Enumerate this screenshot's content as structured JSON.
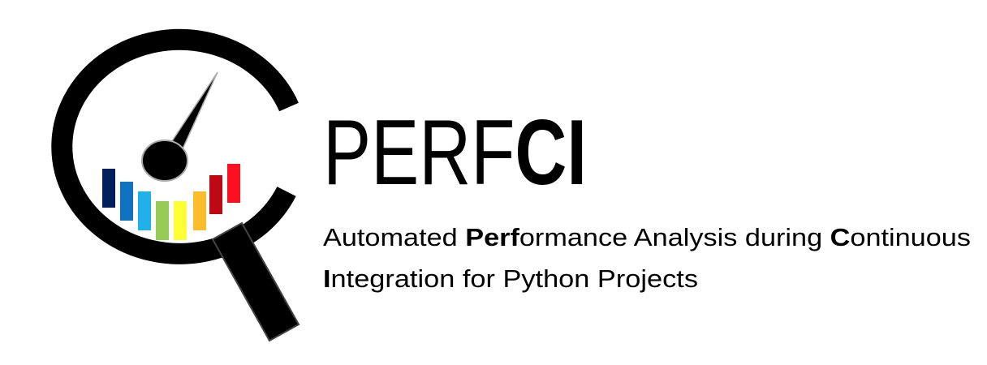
{
  "logo": {
    "title_light": "PERF",
    "title_bold": "CI",
    "bar_colors": [
      "#03205e",
      "#1172bf",
      "#20b0ea",
      "#96cc55",
      "#fefe35",
      "#fcbd2d",
      "#be0914",
      "#fc0f1e"
    ]
  },
  "tagline": {
    "line1": [
      {
        "text": "Automated ",
        "bold": false
      },
      {
        "text": "Perf",
        "bold": true
      },
      {
        "text": "ormance Analysis during ",
        "bold": false
      },
      {
        "text": "C",
        "bold": true
      },
      {
        "text": "ontinuous",
        "bold": false
      }
    ],
    "line2": [
      {
        "text": "I",
        "bold": true
      },
      {
        "text": "ntegration for Python Projects",
        "bold": false
      }
    ]
  }
}
